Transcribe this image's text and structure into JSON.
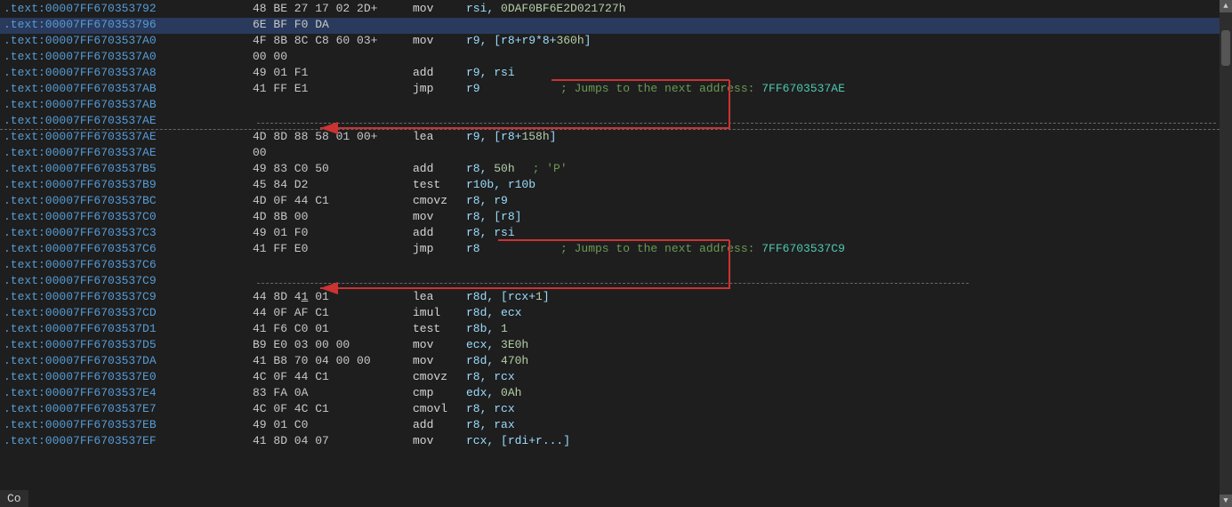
{
  "lines": [
    {
      "addr": ".text:00007FF670353792",
      "bytes": "48 BE 27 17 02 2D+",
      "mnemonic": "mov",
      "operands_raw": "rsi, 0DAF0BF6E2D021727h",
      "operands_color": "mixed",
      "reg": "rsi",
      "separator": "",
      "num": "0DAF0BF6E2D021727h",
      "highlighted": false
    },
    {
      "addr": ".text:00007FF670353796",
      "bytes": "6E BF F0 DA",
      "mnemonic": "",
      "operands_raw": "",
      "highlighted": true
    },
    {
      "addr": ".text:00007FF6703537A0",
      "bytes": "4F 8B 8C C8 60 03+",
      "mnemonic": "mov",
      "operands_raw": "r9, [r8+r9*8+360h]",
      "highlighted": false
    },
    {
      "addr": ".text:00007FF6703537A0",
      "bytes": "00 00",
      "mnemonic": "",
      "operands_raw": "",
      "highlighted": false
    },
    {
      "addr": ".text:00007FF6703537A8",
      "bytes": "49 01 F1",
      "mnemonic": "add",
      "operands_raw": "r9, rsi",
      "highlighted": false
    },
    {
      "addr": ".text:00007FF6703537AB",
      "bytes": "41 FF E1",
      "mnemonic": "jmp",
      "operands_raw": "r9",
      "highlighted": false,
      "annotation": "; Jumps to the next address: 7FF6703537AE"
    },
    {
      "addr": ".text:00007FF6703537AB",
      "bytes": "",
      "mnemonic": "",
      "operands_raw": "",
      "highlighted": false
    },
    {
      "addr": ".text:00007FF6703537AE",
      "bytes": "",
      "mnemonic": "",
      "operands_raw": "",
      "highlighted": false,
      "dashed": true
    },
    {
      "addr": ".text:00007FF6703537AE",
      "bytes": "4D 8D 88 58 01 00+",
      "mnemonic": "lea",
      "operands_raw": "r9, [r8+158h]",
      "highlighted": false
    },
    {
      "addr": ".text:00007FF6703537AE",
      "bytes": "00",
      "mnemonic": "",
      "operands_raw": "",
      "highlighted": false
    },
    {
      "addr": ".text:00007FF6703537B5",
      "bytes": "49 83 C0 50",
      "mnemonic": "add",
      "operands_raw": "r8, 50h",
      "comment": "; 'P'",
      "highlighted": false
    },
    {
      "addr": ".text:00007FF6703537B9",
      "bytes": "45 84 D2",
      "mnemonic": "test",
      "operands_raw": "r10b, r10b",
      "highlighted": false
    },
    {
      "addr": ".text:00007FF6703537BC",
      "bytes": "4D 0F 44 C1",
      "mnemonic": "cmovz",
      "operands_raw": "r8, r9",
      "highlighted": false
    },
    {
      "addr": ".text:00007FF6703537C0",
      "bytes": "4D 8B 00",
      "mnemonic": "mov",
      "operands_raw": "r8, [r8]",
      "highlighted": false
    },
    {
      "addr": ".text:00007FF6703537C3",
      "bytes": "49 01 F0",
      "mnemonic": "add",
      "operands_raw": "r8, rsi",
      "highlighted": false
    },
    {
      "addr": ".text:00007FF6703537C6",
      "bytes": "41 FF E0",
      "mnemonic": "jmp",
      "operands_raw": "r8",
      "highlighted": false,
      "annotation": "; Jumps to the next address: 7FF6703537C9"
    },
    {
      "addr": ".text:00007FF6703537C6",
      "bytes": "",
      "mnemonic": "",
      "operands_raw": "",
      "highlighted": false
    },
    {
      "addr": ".text:00007FF6703537C9",
      "bytes": "",
      "mnemonic": "",
      "operands_raw": "",
      "highlighted": false,
      "dashed": true
    },
    {
      "addr": ".text:00007FF6703537C9",
      "bytes": "44 8D 41 01",
      "mnemonic": "lea",
      "operands_raw": "r8d, [rcx+1]",
      "highlighted": false
    },
    {
      "addr": ".text:00007FF6703537CD",
      "bytes": "44 0F AF C1",
      "mnemonic": "imul",
      "operands_raw": "r8d, ecx",
      "highlighted": false
    },
    {
      "addr": ".text:00007FF6703537D1",
      "bytes": "41 F6 C0 01",
      "mnemonic": "test",
      "operands_raw": "r8b, 1",
      "highlighted": false
    },
    {
      "addr": ".text:00007FF6703537D5",
      "bytes": "B9 E0 03 00 00",
      "mnemonic": "mov",
      "operands_raw": "ecx, 3E0h",
      "highlighted": false
    },
    {
      "addr": ".text:00007FF6703537DA",
      "bytes": "41 B8 70 04 00 00",
      "mnemonic": "mov",
      "operands_raw": "r8d, 470h",
      "highlighted": false
    },
    {
      "addr": ".text:00007FF6703537E0",
      "bytes": "4C 0F 44 C1",
      "mnemonic": "cmovz",
      "operands_raw": "r8, rcx",
      "highlighted": false
    },
    {
      "addr": ".text:00007FF6703537E4",
      "bytes": "83 FA 0A",
      "mnemonic": "cmp",
      "operands_raw": "edx, 0Ah",
      "highlighted": false
    },
    {
      "addr": ".text:00007FF6703537E7",
      "bytes": "4C 0F 4C C1",
      "mnemonic": "cmovl",
      "operands_raw": "r8, rcx",
      "highlighted": false
    },
    {
      "addr": ".text:00007FF6703537EB",
      "bytes": "49 01 C0",
      "mnemonic": "add",
      "operands_raw": "r8, rax",
      "highlighted": false
    },
    {
      "addr": ".text:00007FF6703537EF",
      "bytes": "41 8D 04 07",
      "mnemonic": "mov",
      "operands_raw": "rcx, [rdi+r...]",
      "highlighted": false,
      "partial": true
    }
  ],
  "annotations": {
    "jmp1": "; Jumps to the next address: ",
    "jmp1_addr": "7FF6703537AE",
    "jmp2": "; Jumps to the next address: ",
    "jmp2_addr": "7FF6703537C9"
  },
  "bottom_text": "Co"
}
